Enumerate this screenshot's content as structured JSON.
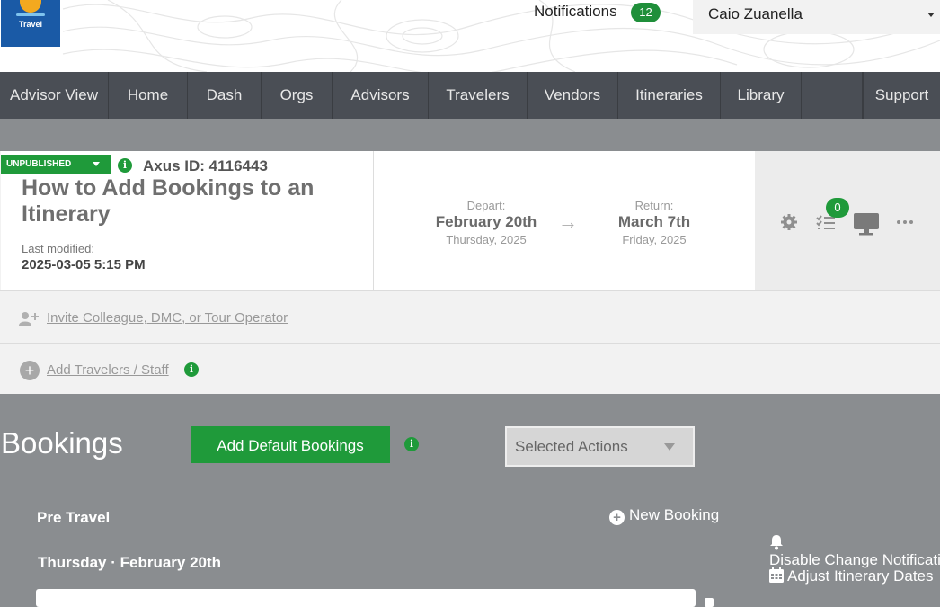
{
  "header": {
    "logo_text": "Travel",
    "notifications_label": "Notifications",
    "notifications_count": "12",
    "user_name": "Caio Zuanella"
  },
  "nav": {
    "items": [
      "Advisor View",
      "Home",
      "Dash",
      "Orgs",
      "Advisors",
      "Travelers",
      "Vendors",
      "Itineraries",
      "Library",
      "Support"
    ]
  },
  "itinerary": {
    "status": "UNPUBLISHED",
    "axus_id": "Axus ID: 4116443",
    "title": "How to Add Bookings to an Itinerary",
    "last_modified_label": "Last modified:",
    "last_modified_value": "2025-03-05 5:15 PM",
    "depart_label": "Depart:",
    "depart_date": "February 20th",
    "depart_day": "Thursday, 2025",
    "return_label": "Return:",
    "return_date": "March 7th",
    "return_day": "Friday, 2025",
    "arrow": "→",
    "tasks_count": "0",
    "invite_link": "Invite Colleague, DMC, or Tour Operator",
    "add_travelers_link": "Add Travelers / Staff"
  },
  "bookings": {
    "title": "Bookings",
    "add_default_button": "Add Default Bookings",
    "selected_actions": "Selected Actions",
    "pre_travel": "Pre Travel",
    "new_booking": "New Booking",
    "day_label": "Thursday · February 20th",
    "disable_notifications": "Disable Change Notifications",
    "adjust_dates": "Adjust Itinerary Dates"
  },
  "colors": {
    "accent_green": "#1f9a3a",
    "nav_bg": "#4a4e55",
    "page_bg": "#8a8d90"
  }
}
